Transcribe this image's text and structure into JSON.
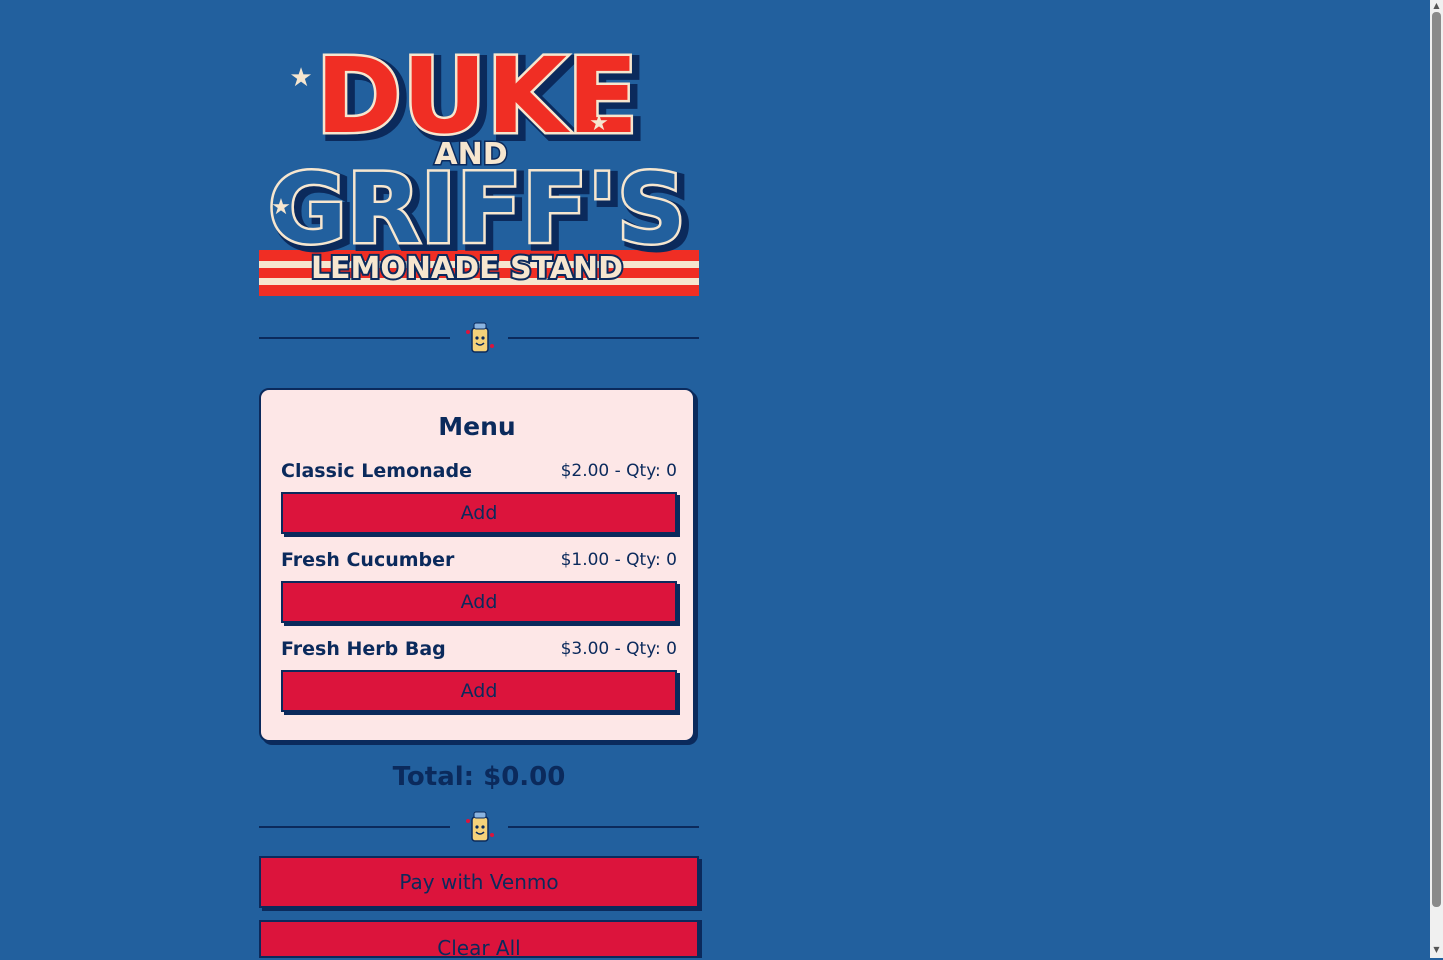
{
  "logo": {
    "line1": "DUKE",
    "line2": "AND",
    "line3": "GRIFF'S",
    "line4": "LEMONADE STAND"
  },
  "menu": {
    "title": "Menu",
    "items": [
      {
        "name": "Classic Lemonade",
        "meta": "$2.00 - Qty: 0",
        "button": "Add"
      },
      {
        "name": "Fresh Cucumber",
        "meta": "$1.00 - Qty: 0",
        "button": "Add"
      },
      {
        "name": "Fresh Herb Bag",
        "meta": "$3.00 - Qty: 0",
        "button": "Add"
      }
    ]
  },
  "total": "Total: $0.00",
  "actions": {
    "venmo": "Pay with Venmo",
    "clear": "Clear All"
  },
  "colors": {
    "background": "#22609e",
    "navy": "#0b2a5c",
    "red": "#dc143c",
    "card": "#fde7e7"
  },
  "icons": {
    "divider": "lemonade-mascot-icon"
  }
}
